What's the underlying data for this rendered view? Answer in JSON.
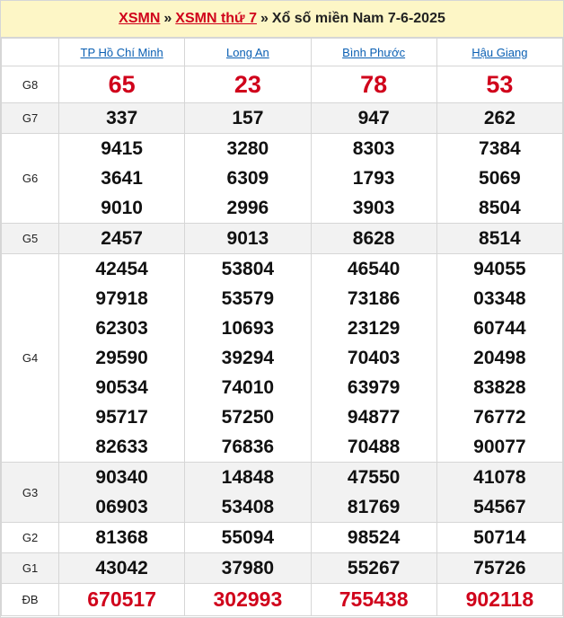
{
  "header": {
    "crumb1": "XSMN",
    "crumb2": "XSMN thứ 7",
    "separator": "»",
    "title": "Xổ số miền Nam 7-6-2025"
  },
  "provinces": [
    "TP Hồ Chí Minh",
    "Long An",
    "Bình Phước",
    "Hậu Giang"
  ],
  "prizes": [
    {
      "label": "G8",
      "values": [
        [
          "65"
        ],
        [
          "23"
        ],
        [
          "78"
        ],
        [
          "53"
        ]
      ]
    },
    {
      "label": "G7",
      "values": [
        [
          "337"
        ],
        [
          "157"
        ],
        [
          "947"
        ],
        [
          "262"
        ]
      ]
    },
    {
      "label": "G6",
      "values": [
        [
          "9415",
          "3641",
          "9010"
        ],
        [
          "3280",
          "6309",
          "2996"
        ],
        [
          "8303",
          "1793",
          "3903"
        ],
        [
          "7384",
          "5069",
          "8504"
        ]
      ]
    },
    {
      "label": "G5",
      "values": [
        [
          "2457"
        ],
        [
          "9013"
        ],
        [
          "8628"
        ],
        [
          "8514"
        ]
      ]
    },
    {
      "label": "G4",
      "values": [
        [
          "42454",
          "97918",
          "62303",
          "29590",
          "90534",
          "95717",
          "82633"
        ],
        [
          "53804",
          "53579",
          "10693",
          "39294",
          "74010",
          "57250",
          "76836"
        ],
        [
          "46540",
          "73186",
          "23129",
          "70403",
          "63979",
          "94877",
          "70488"
        ],
        [
          "94055",
          "03348",
          "60744",
          "20498",
          "83828",
          "76772",
          "90077"
        ]
      ]
    },
    {
      "label": "G3",
      "values": [
        [
          "90340",
          "06903"
        ],
        [
          "14848",
          "53408"
        ],
        [
          "47550",
          "81769"
        ],
        [
          "41078",
          "54567"
        ]
      ]
    },
    {
      "label": "G2",
      "values": [
        [
          "81368"
        ],
        [
          "55094"
        ],
        [
          "98524"
        ],
        [
          "50714"
        ]
      ]
    },
    {
      "label": "G1",
      "values": [
        [
          "43042"
        ],
        [
          "37980"
        ],
        [
          "55267"
        ],
        [
          "75726"
        ]
      ]
    },
    {
      "label": "ĐB",
      "values": [
        [
          "670517"
        ],
        [
          "302993"
        ],
        [
          "755438"
        ],
        [
          "902118"
        ]
      ]
    }
  ]
}
